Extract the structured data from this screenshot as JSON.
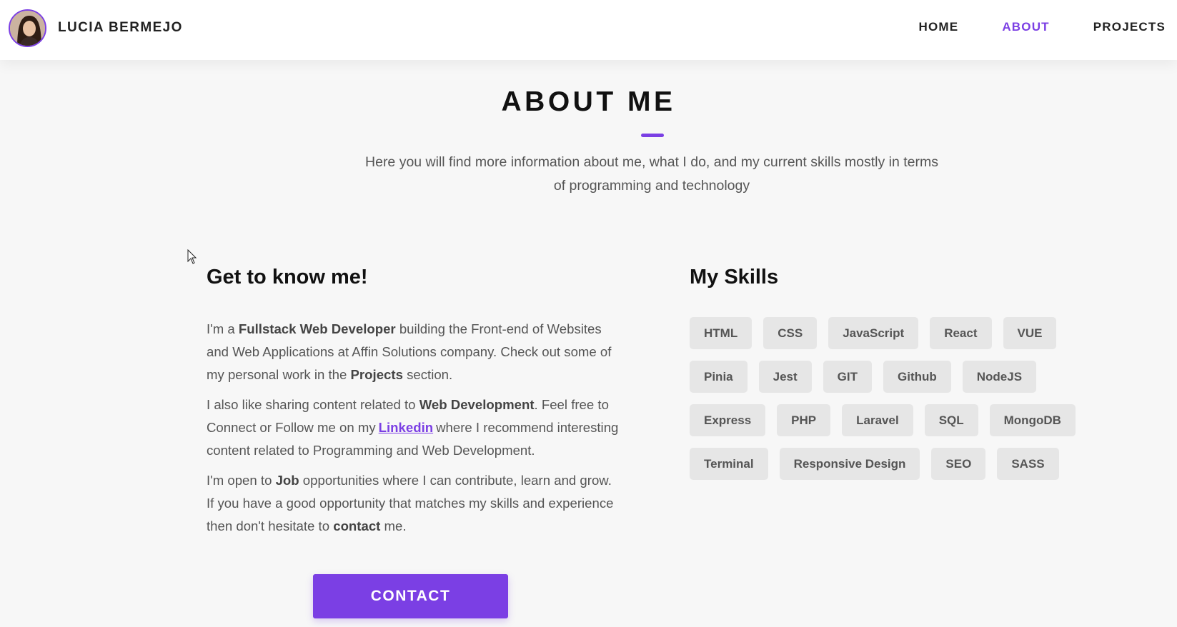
{
  "header": {
    "brand": "LUCIA BERMEJO",
    "nav": [
      {
        "label": "HOME",
        "active": false
      },
      {
        "label": "ABOUT",
        "active": true
      },
      {
        "label": "PROJECTS",
        "active": false
      }
    ]
  },
  "about": {
    "title": "ABOUT ME",
    "subtitle": "Here you will find more information about me, what I do, and my current skills mostly in terms of programming and technology",
    "know_heading": "Get to know me!",
    "p1": {
      "t1": "I'm a ",
      "b1": "Fullstack Web Developer",
      "t2": " building the Front-end of Websites and Web Applications at Affin Solutions company. Check out some of my personal work in the ",
      "b2": "Projects",
      "t3": " section."
    },
    "p2": {
      "t1": "I also like sharing content related to ",
      "b1": "Web Development",
      "t2": ". Feel free to Connect or Follow me on my",
      "link": "Linkedin",
      "t3": "where I recommend interesting content related to Programming and Web Development."
    },
    "p3": {
      "t1": "I'm open to ",
      "b1": "Job",
      "t2": " opportunities where I can contribute, learn and grow. If you have a good opportunity that matches my skills and experience then don't hesitate to ",
      "b2": "contact",
      "t3": " me."
    },
    "contact_label": "CONTACT"
  },
  "skills": {
    "heading": "My Skills",
    "items": [
      "HTML",
      "CSS",
      "JavaScript",
      "React",
      "VUE",
      "Pinia",
      "Jest",
      "GIT",
      "Github",
      "NodeJS",
      "Express",
      "PHP",
      "Laravel",
      "SQL",
      "MongoDB",
      "Terminal",
      "Responsive Design",
      "SEO",
      "SASS"
    ]
  },
  "colors": {
    "accent": "#7b3fe4",
    "background": "#f7f7f7",
    "chip": "#e6e6e6"
  }
}
